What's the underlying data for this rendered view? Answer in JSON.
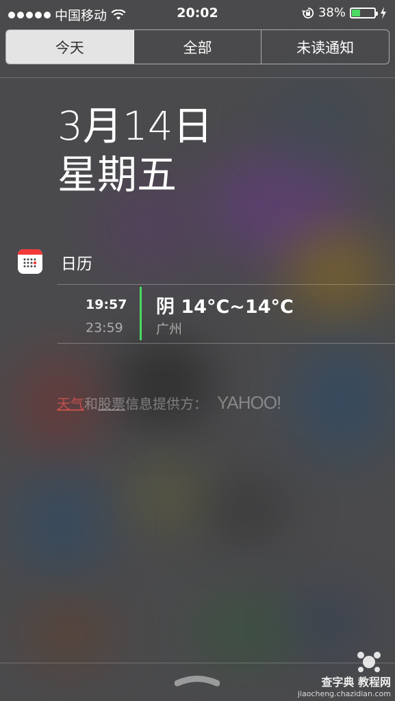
{
  "status_bar": {
    "carrier": "中国移动",
    "time": "20:02",
    "battery_percent": "38%",
    "battery_level": 0.38
  },
  "segments": [
    {
      "label": "今天",
      "active": true
    },
    {
      "label": "全部",
      "active": false
    },
    {
      "label": "未读通知",
      "active": false
    }
  ],
  "today": {
    "date": "3月14日",
    "weekday": "星期五"
  },
  "calendar": {
    "title": "日历",
    "event": {
      "start_time": "19:57",
      "end_time": "23:59",
      "title": "阴 14°C~14°C",
      "location": "广州"
    }
  },
  "attribution": {
    "weather": "天气",
    "and": "和",
    "stocks": "股票",
    "provided_by": "信息提供方：",
    "provider": "YAHOO!"
  },
  "watermark": {
    "line1": "查字典 教程网",
    "line2": "jiaocheng.chazidian.com"
  },
  "colors": {
    "accent_green": "#4cd964",
    "calendar_red": "#f23a3a",
    "weather_link": "#c0504d"
  }
}
